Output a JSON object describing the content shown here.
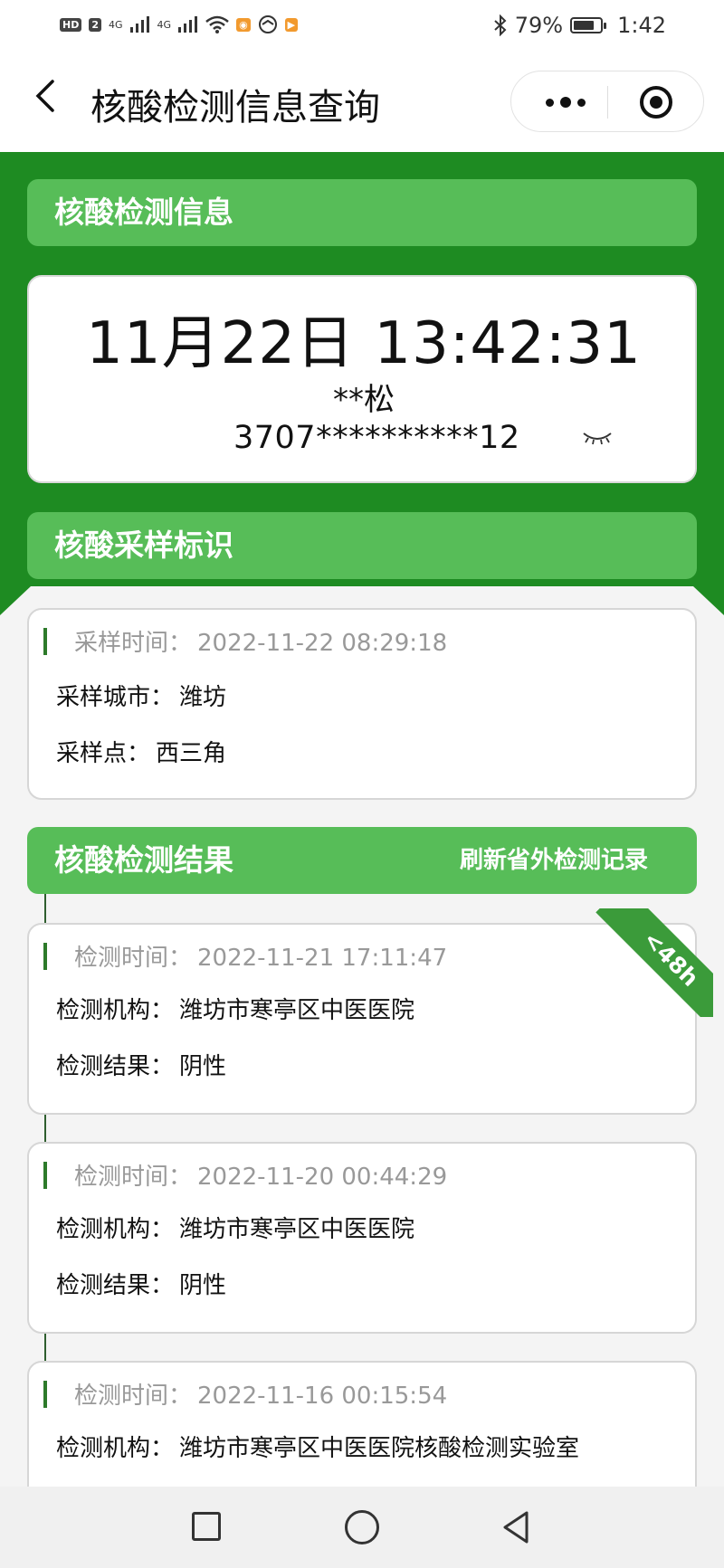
{
  "status_bar": {
    "network1": "4G",
    "network2": "4G",
    "chip_hd": "HD",
    "chip_sim": "2",
    "battery_percent": "79%",
    "battery_level": 0.79,
    "time": "1:42",
    "icons": [
      "signal-icon",
      "wifi-icon",
      "weibo-icon",
      "browser-icon",
      "video-app-icon",
      "bluetooth-icon",
      "battery-icon"
    ]
  },
  "nav": {
    "title": "核酸检测信息查询"
  },
  "info_section": {
    "header": "核酸检测信息",
    "datetime": "11月22日 13:42:31",
    "name": "**松",
    "id_number": "3707**********12"
  },
  "sampling_section": {
    "header": "核酸采样标识",
    "time_label": "采样时间：",
    "time": "2022-11-22 08:29:18",
    "city_label": "采样城市：",
    "city": "潍坊",
    "site_label": "采样点：",
    "site": "西三角"
  },
  "results_section": {
    "header": "核酸检测结果",
    "refresh_label": "刷新省外检测记录",
    "badge": "<48h",
    "time_label": "检测时间：",
    "org_label": "检测机构：",
    "result_label": "检测结果：",
    "records": [
      {
        "time": "2022-11-21 17:11:47",
        "org": "潍坊市寒亭区中医医院",
        "result": "阴性"
      },
      {
        "time": "2022-11-20 00:44:29",
        "org": "潍坊市寒亭区中医医院",
        "result": "阴性"
      },
      {
        "time": "2022-11-16 00:15:54",
        "org": "潍坊市寒亭区中医医院核酸检测实验室",
        "result": ""
      }
    ]
  },
  "colors": {
    "band_green": "#1e8b22",
    "header_green": "#57bd58",
    "ribbon_green": "#3b9b3a"
  }
}
